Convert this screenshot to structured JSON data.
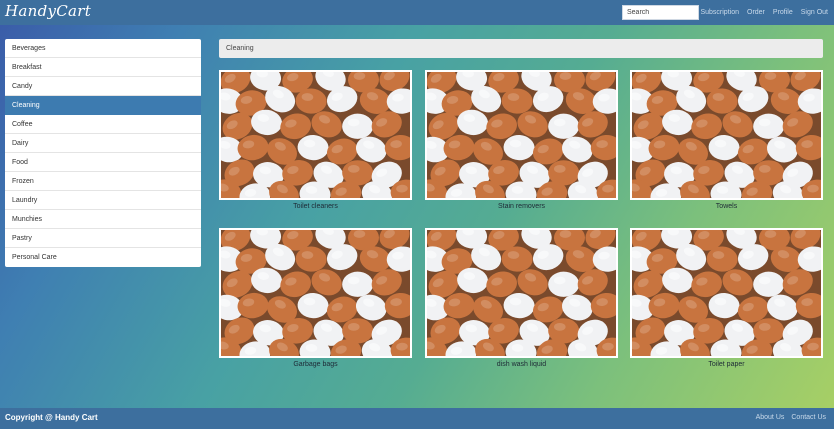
{
  "navbar": {
    "brand": "HandyCart",
    "search_placeholder": "Search",
    "links": [
      "Subscription",
      "Order",
      "Profile",
      "Sign Out"
    ]
  },
  "sidebar": {
    "active_index": 3,
    "items": [
      "Beverages",
      "Breakfast",
      "Candy",
      "Cleaning",
      "Coffee",
      "Dairy",
      "Food",
      "Frozen",
      "Laundry",
      "Munchies",
      "Pastry",
      "Personal Care"
    ]
  },
  "breadcrumb": "Cleaning",
  "products": [
    {
      "label": "Toilet cleaners",
      "image": "eggs-photo"
    },
    {
      "label": "Stain removers",
      "image": "eggs-photo"
    },
    {
      "label": "Towels",
      "image": "eggs-photo"
    },
    {
      "label": "Garbage bags",
      "image": "eggs-photo"
    },
    {
      "label": "dish wash liquid",
      "image": "eggs-photo"
    },
    {
      "label": "Toilet paper",
      "image": "eggs-photo"
    }
  ],
  "footer": {
    "copyright": "Copyright @ Handy Cart",
    "links": [
      "About Us",
      "Contact Us"
    ]
  },
  "colors": {
    "navbar": "#3d6f9e",
    "active_item": "#3d7bb0",
    "brown_egg": "#c8743f",
    "white_egg": "#f1f2f4"
  }
}
